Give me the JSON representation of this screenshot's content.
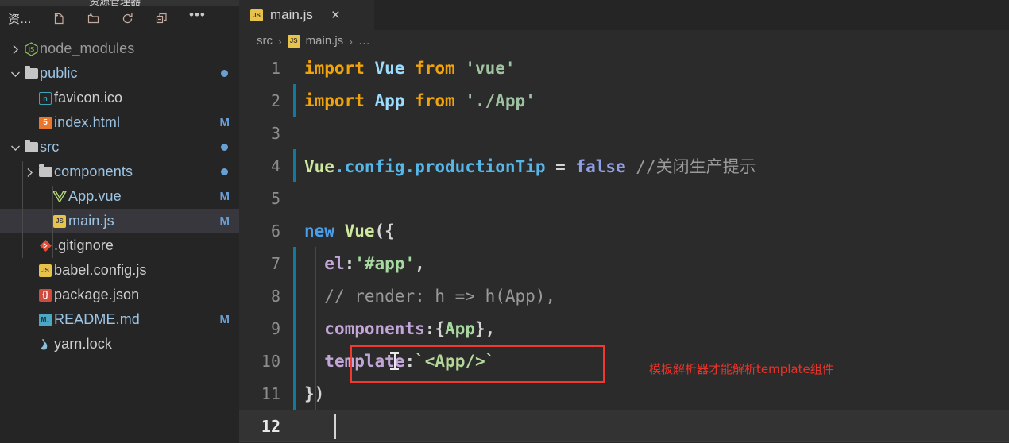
{
  "window": {
    "clipped_title": "资源管理器"
  },
  "sidebar": {
    "title": "资…",
    "toolbar": [
      {
        "name": "new-file-icon",
        "label": "新建文件"
      },
      {
        "name": "new-folder-icon",
        "label": "新建文件夹"
      },
      {
        "name": "refresh-icon",
        "label": "刷新资源管理器"
      },
      {
        "name": "collapse-all-icon",
        "label": "在资源管理器中折叠文件夹"
      },
      {
        "name": "more-actions-icon",
        "label": "…"
      }
    ],
    "tree": [
      {
        "label": "node_modules",
        "icon": "nodejs-icon",
        "type": "folder",
        "indent": 0,
        "expanded": false,
        "twisty": "chevron-right",
        "status": "",
        "dot": false,
        "selected": false,
        "color": "muted"
      },
      {
        "label": "public",
        "icon": "folder-icon",
        "type": "folder",
        "indent": 0,
        "expanded": true,
        "twisty": "chevron-down",
        "status": "",
        "dot": true,
        "selected": false,
        "color": "link"
      },
      {
        "label": "favicon.ico",
        "icon": "ico-file-icon",
        "type": "file",
        "indent": 1,
        "twisty": "",
        "status": "",
        "dot": false,
        "selected": false,
        "color": "plain"
      },
      {
        "label": "index.html",
        "icon": "html-file-icon",
        "type": "file",
        "indent": 1,
        "twisty": "",
        "status": "M",
        "dot": false,
        "selected": false,
        "color": "link"
      },
      {
        "label": "src",
        "icon": "folder-icon",
        "type": "folder",
        "indent": 0,
        "expanded": true,
        "twisty": "chevron-down",
        "status": "",
        "dot": true,
        "selected": false,
        "color": "link"
      },
      {
        "label": "components",
        "icon": "folder-icon",
        "type": "folder",
        "indent": 1,
        "expanded": false,
        "twisty": "chevron-right",
        "status": "",
        "dot": true,
        "selected": false,
        "color": "link"
      },
      {
        "label": "App.vue",
        "icon": "vue-file-icon",
        "type": "file",
        "indent": 2,
        "twisty": "",
        "status": "M",
        "dot": false,
        "selected": false,
        "color": "link"
      },
      {
        "label": "main.js",
        "icon": "js-file-icon",
        "type": "file",
        "indent": 2,
        "twisty": "",
        "status": "M",
        "dot": false,
        "selected": true,
        "color": "link"
      },
      {
        "label": ".gitignore",
        "icon": "git-file-icon",
        "type": "file",
        "indent": 1,
        "twisty": "",
        "status": "",
        "dot": false,
        "selected": false,
        "color": "plain"
      },
      {
        "label": "babel.config.js",
        "icon": "js-file-icon",
        "type": "file",
        "indent": 1,
        "twisty": "",
        "status": "",
        "dot": false,
        "selected": false,
        "color": "plain"
      },
      {
        "label": "package.json",
        "icon": "json-file-icon",
        "type": "file",
        "indent": 1,
        "twisty": "",
        "status": "",
        "dot": false,
        "selected": false,
        "color": "plain"
      },
      {
        "label": "README.md",
        "icon": "md-file-icon",
        "type": "file",
        "indent": 1,
        "twisty": "",
        "status": "M",
        "dot": false,
        "selected": false,
        "color": "link"
      },
      {
        "label": "yarn.lock",
        "icon": "yarn-file-icon",
        "type": "file",
        "indent": 1,
        "twisty": "",
        "status": "",
        "dot": false,
        "selected": false,
        "color": "plain"
      }
    ]
  },
  "editor": {
    "tab": {
      "label": "main.js",
      "icon": "js-file-icon",
      "close_label": "×",
      "active": true
    },
    "breadcrumb": {
      "items": [
        "src",
        "main.js",
        "…"
      ],
      "separator": "›"
    },
    "active_line": 12,
    "caret_line": 12,
    "lines": [
      {
        "n": "1",
        "changed": false,
        "tokens": [
          {
            "t": "import",
            "c": "k-import"
          },
          {
            "t": " ",
            "c": "k-plain"
          },
          {
            "t": "Vue",
            "c": "k-ident"
          },
          {
            "t": " ",
            "c": "k-plain"
          },
          {
            "t": "from",
            "c": "k-import"
          },
          {
            "t": " ",
            "c": "k-plain"
          },
          {
            "t": "'vue'",
            "c": "k-str"
          }
        ]
      },
      {
        "n": "2",
        "changed": true,
        "tokens": [
          {
            "t": "import",
            "c": "k-import"
          },
          {
            "t": " ",
            "c": "k-plain"
          },
          {
            "t": "App",
            "c": "k-ident"
          },
          {
            "t": " ",
            "c": "k-plain"
          },
          {
            "t": "from",
            "c": "k-import"
          },
          {
            "t": " ",
            "c": "k-plain"
          },
          {
            "t": "'./App'",
            "c": "k-str"
          }
        ]
      },
      {
        "n": "3",
        "changed": false,
        "tokens": []
      },
      {
        "n": "4",
        "changed": true,
        "tokens": [
          {
            "t": "Vue",
            "c": "k-vue"
          },
          {
            "t": ".",
            "c": "k-prop"
          },
          {
            "t": "config",
            "c": "k-prop"
          },
          {
            "t": ".",
            "c": "k-prop"
          },
          {
            "t": "productionTip",
            "c": "k-prop"
          },
          {
            "t": " = ",
            "c": "k-plain"
          },
          {
            "t": "false",
            "c": "k-bool"
          },
          {
            "t": " ",
            "c": "k-plain"
          },
          {
            "t": "//关闭生产提示",
            "c": "k-comment"
          }
        ]
      },
      {
        "n": "5",
        "changed": false,
        "tokens": []
      },
      {
        "n": "6",
        "changed": false,
        "tokens": [
          {
            "t": "new",
            "c": "k-new"
          },
          {
            "t": " ",
            "c": "k-plain"
          },
          {
            "t": "Vue",
            "c": "k-vue"
          },
          {
            "t": "({",
            "c": "k-plain"
          }
        ]
      },
      {
        "n": "7",
        "changed": true,
        "tokens": [
          {
            "t": "  ",
            "c": "k-plain"
          },
          {
            "t": "el",
            "c": "k-key"
          },
          {
            "t": ":",
            "c": "k-plain"
          },
          {
            "t": "'#app'",
            "c": "k-green"
          },
          {
            "t": ",",
            "c": "k-plain"
          }
        ]
      },
      {
        "n": "8",
        "changed": true,
        "tokens": [
          {
            "t": "  ",
            "c": "k-plain"
          },
          {
            "t": "// render: h => h(App),",
            "c": "k-comment"
          }
        ]
      },
      {
        "n": "9",
        "changed": true,
        "tokens": [
          {
            "t": "  ",
            "c": "k-plain"
          },
          {
            "t": "components",
            "c": "k-key"
          },
          {
            "t": ":{",
            "c": "k-plain"
          },
          {
            "t": "App",
            "c": "k-green"
          },
          {
            "t": "},",
            "c": "k-plain"
          }
        ]
      },
      {
        "n": "10",
        "changed": true,
        "tokens": [
          {
            "t": "  ",
            "c": "k-plain"
          },
          {
            "t": "template",
            "c": "k-key"
          },
          {
            "t": ":",
            "c": "k-plain"
          },
          {
            "t": "`",
            "c": "k-tag"
          },
          {
            "t": "<App/>",
            "c": "k-tag"
          },
          {
            "t": "`",
            "c": "k-tag"
          }
        ]
      },
      {
        "n": "11",
        "changed": true,
        "tokens": [
          {
            "t": "})",
            "c": "k-plain"
          }
        ]
      },
      {
        "n": "12",
        "changed": false,
        "tokens": []
      }
    ],
    "annotation": {
      "text": "模板解析器才能解析template组件",
      "color": "#e8332a"
    },
    "highlight_box": {
      "color": "#f03a2f",
      "target_line": 10
    }
  },
  "colors": {
    "editor_bg": "#2b2b2b",
    "sidebar_bg": "#252526",
    "selection_bg": "#37373d",
    "accent_link": "#9cc4e4",
    "git_change": "#0f7b9c",
    "annotation_red": "#e8332a"
  }
}
